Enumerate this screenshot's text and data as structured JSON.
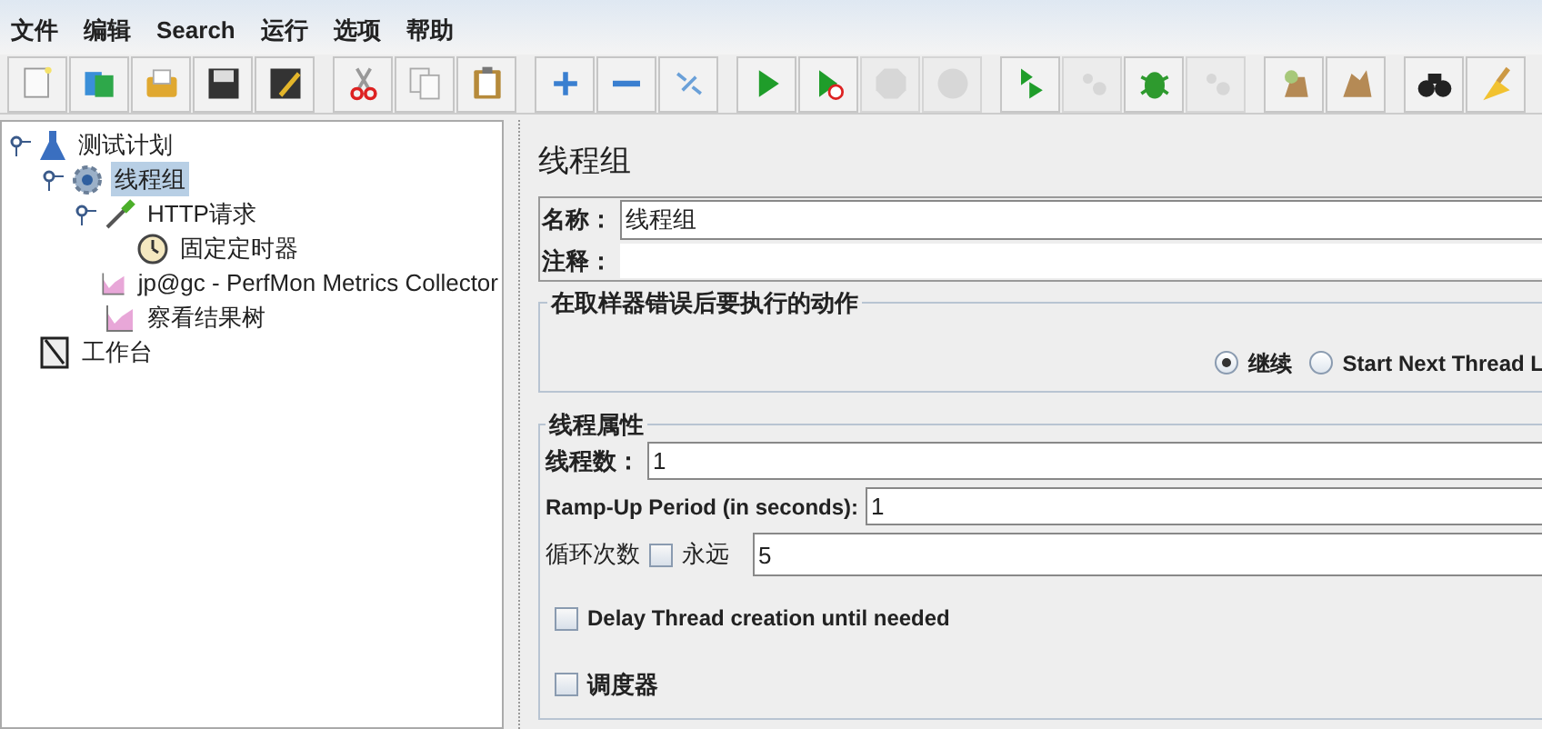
{
  "menu": [
    "文件",
    "编辑",
    "Search",
    "运行",
    "选项",
    "帮助"
  ],
  "toolbar": [
    [
      {
        "kind": "new",
        "disabled": false
      },
      {
        "kind": "templates",
        "disabled": false
      },
      {
        "kind": "open",
        "disabled": false
      },
      {
        "kind": "save",
        "disabled": false
      },
      {
        "kind": "save-as",
        "disabled": false
      }
    ],
    [
      {
        "kind": "cut",
        "disabled": false
      },
      {
        "kind": "copy",
        "disabled": false
      },
      {
        "kind": "paste",
        "disabled": false
      }
    ],
    [
      {
        "kind": "add",
        "disabled": false
      },
      {
        "kind": "remove",
        "disabled": false
      },
      {
        "kind": "toggle",
        "disabled": false
      }
    ],
    [
      {
        "kind": "start",
        "disabled": false
      },
      {
        "kind": "start-no-timers",
        "disabled": false
      },
      {
        "kind": "stop",
        "disabled": true
      },
      {
        "kind": "shutdown",
        "disabled": true
      }
    ],
    [
      {
        "kind": "remote-start",
        "disabled": false
      },
      {
        "kind": "remote-stop",
        "disabled": true
      },
      {
        "kind": "debug",
        "disabled": false
      },
      {
        "kind": "remote-exit",
        "disabled": true
      }
    ],
    [
      {
        "kind": "clear",
        "disabled": false
      },
      {
        "kind": "clear-all",
        "disabled": false
      }
    ],
    [
      {
        "kind": "search",
        "disabled": false
      },
      {
        "kind": "reset",
        "disabled": false
      }
    ]
  ],
  "tree": [
    {
      "label": "测试计划",
      "kind": "plan",
      "selected": false,
      "expanded": true,
      "children": [
        {
          "label": "线程组",
          "kind": "thread-group",
          "selected": true,
          "expanded": true,
          "children": [
            {
              "label": "HTTP请求",
              "kind": "sampler",
              "selected": false,
              "expanded": true,
              "children": [
                {
                  "label": "固定定时器",
                  "kind": "timer",
                  "selected": false
                }
              ]
            },
            {
              "label": "jp@gc - PerfMon Metrics Collector",
              "kind": "listener",
              "selected": false
            },
            {
              "label": "察看结果树",
              "kind": "listener",
              "selected": false
            }
          ]
        }
      ]
    },
    {
      "label": "工作台",
      "kind": "workbench",
      "selected": false
    }
  ],
  "panel": {
    "title": "线程组",
    "name_label": "名称：",
    "name_value": "线程组",
    "comment_label": "注释：",
    "error_action": {
      "legend": "在取样器错误后要执行的动作",
      "options": [
        {
          "label": "继续",
          "selected": true
        },
        {
          "label": "Start Next Thread L",
          "selected": false
        }
      ]
    },
    "thread_props": {
      "legend": "线程属性",
      "threads_label": "线程数：",
      "threads_value": "1",
      "rampup_label": "Ramp-Up Period (in seconds):",
      "rampup_value": "1",
      "loop_label": "循环次数",
      "forever": {
        "label": "永远",
        "checked": false
      },
      "loop_value": "5",
      "delay": {
        "label": "Delay Thread creation until needed",
        "checked": false
      },
      "scheduler": {
        "label": "调度器",
        "checked": false
      }
    }
  }
}
